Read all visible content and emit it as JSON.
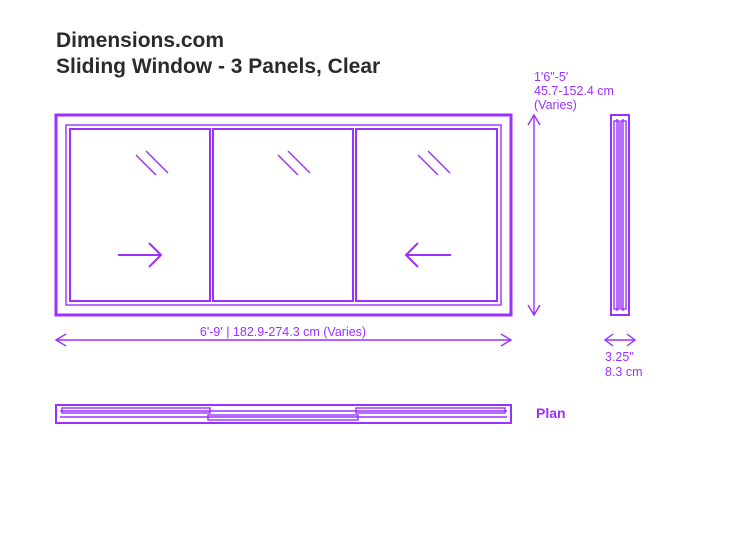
{
  "title": {
    "site": "Dimensions.com",
    "name": "Sliding Window - 3 Panels, Clear"
  },
  "dimensions": {
    "height_imperial": "1'6\"-5'",
    "height_metric": "45.7-152.4 cm",
    "height_note": "(Varies)",
    "width_combined": "6'-9' | 182.9-274.3 cm (Varies)",
    "depth_imperial": "3.25\"",
    "depth_metric": "8.3 cm"
  },
  "labels": {
    "plan": "Plan"
  }
}
